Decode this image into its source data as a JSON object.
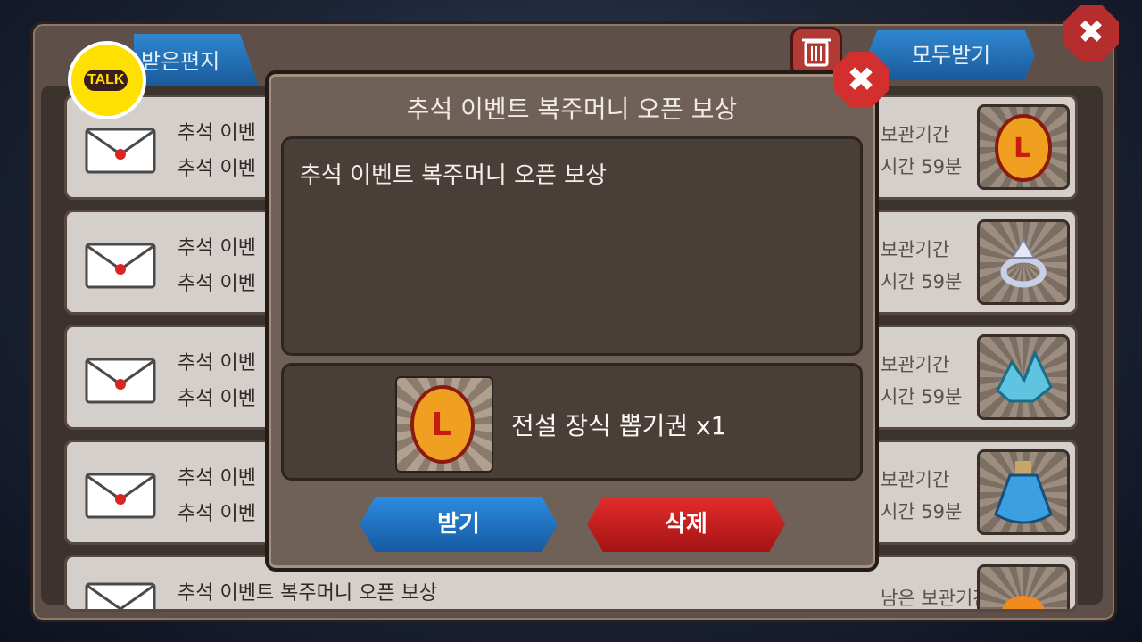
{
  "mailbox": {
    "tab_label": "받은편지",
    "receive_all_label": "모두받기",
    "rows": [
      {
        "title": "추석 이벤",
        "title2": "추석 이벤",
        "keep1": "보관기간",
        "keep2": "시간 59분"
      },
      {
        "title": "추석 이벤",
        "title2": "추석 이벤",
        "keep1": "보관기간",
        "keep2": "시간 59분"
      },
      {
        "title": "추석 이벤",
        "title2": "추석 이벤",
        "keep1": "보관기간",
        "keep2": "시간 59분"
      },
      {
        "title": "추석 이벤",
        "title2": "추석 이벤",
        "keep1": "보관기간",
        "keep2": "시간 59분"
      },
      {
        "title": "추석 이벤트 복주머니 오픈 보상",
        "title2": "",
        "keep1": "남은 보관기간",
        "keep2": ""
      }
    ]
  },
  "talk_badge": "TALK",
  "modal": {
    "title": "추석 이벤트 복주머니 오픈 보상",
    "message": "추석 이벤트 복주머니 오픈 보상",
    "reward_text": "전설 장식 뽑기권 x1",
    "receive_label": "받기",
    "delete_label": "삭제",
    "close_glyph": "✖"
  },
  "close_glyph": "✖",
  "colors": {
    "accent_blue": "#1f6fb8",
    "danger_red": "#c91d1d",
    "talk_yellow": "#ffe000"
  }
}
